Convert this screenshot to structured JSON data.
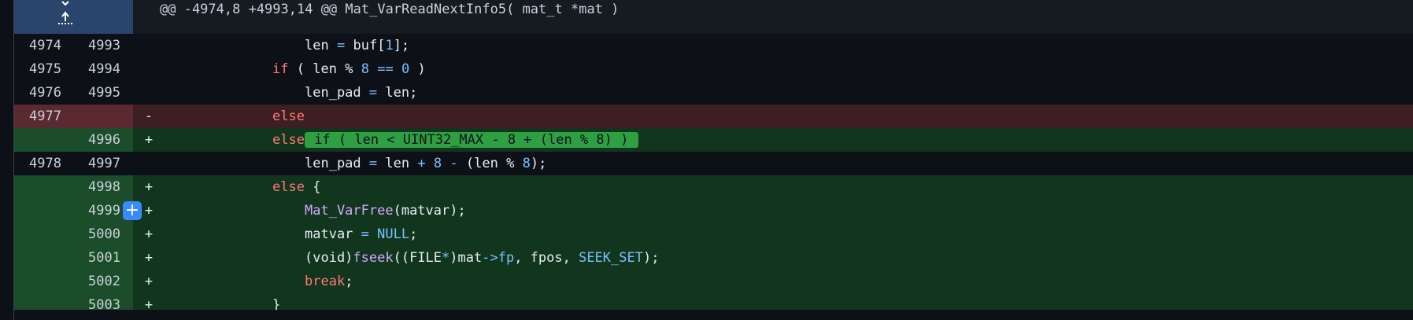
{
  "hunk": {
    "header": "@@ -4974,8 +4993,14 @@ Mat_VarReadNextInfo5( mat_t *mat )"
  },
  "rows": {
    "r1": {
      "old": "4974",
      "new": "4993",
      "marker": ""
    },
    "r2": {
      "old": "4975",
      "new": "4994",
      "marker": ""
    },
    "r3": {
      "old": "4976",
      "new": "4995",
      "marker": ""
    },
    "r4": {
      "old": "4977",
      "new": "",
      "marker": "-"
    },
    "r5": {
      "old": "",
      "new": "4996",
      "marker": "+"
    },
    "r6": {
      "old": "4978",
      "new": "4997",
      "marker": ""
    },
    "r7": {
      "old": "",
      "new": "4998",
      "marker": "+"
    },
    "r8": {
      "old": "",
      "new": "4999",
      "marker": "+"
    },
    "r9": {
      "old": "",
      "new": "5000",
      "marker": "+"
    },
    "r10": {
      "old": "",
      "new": "5001",
      "marker": "+"
    },
    "r11": {
      "old": "",
      "new": "5002",
      "marker": "+"
    },
    "r12": {
      "old": "",
      "new": "5003",
      "marker": "+"
    }
  },
  "tok": {
    "len": "len",
    "eq": "=",
    "buf": "buf",
    "lb": "[",
    "rb": "];",
    "one": "1",
    "if": "if",
    "lp": "(",
    "rp": ")",
    "pct": "%",
    "eight": "8",
    "eqeq": "==",
    "zero": "0",
    "len_pad": "len_pad",
    "semi": ";",
    "else": "else",
    "added_cond": " if ( len < UINT32_MAX - 8 + (len % 8) ) ",
    "plus": "+",
    "minus": "-",
    "lenpct": "(len",
    "rpsemi": ");",
    "brace_open": "{",
    "brace_close": "}",
    "mat_varfree": "Mat_VarFree",
    "matvar_arg": "(matvar);",
    "matvar": "matvar",
    "null": "NULL",
    "voidcast": "(void)",
    "fseek": "fseek",
    "file_cast": "((FILE",
    "star": "*",
    "mat_close": ")mat",
    "arrow_fp": "->fp",
    "fpos": ", fpos, ",
    "seek_set": "SEEK_SET",
    "break": "break"
  },
  "icons": {
    "expand": "unfold-icon",
    "add_comment": "plus-icon"
  },
  "colors": {
    "added_bg": "#12351e",
    "deleted_bg": "#3c1e23",
    "highlight": "#2ea043",
    "accent": "#388bfd"
  }
}
